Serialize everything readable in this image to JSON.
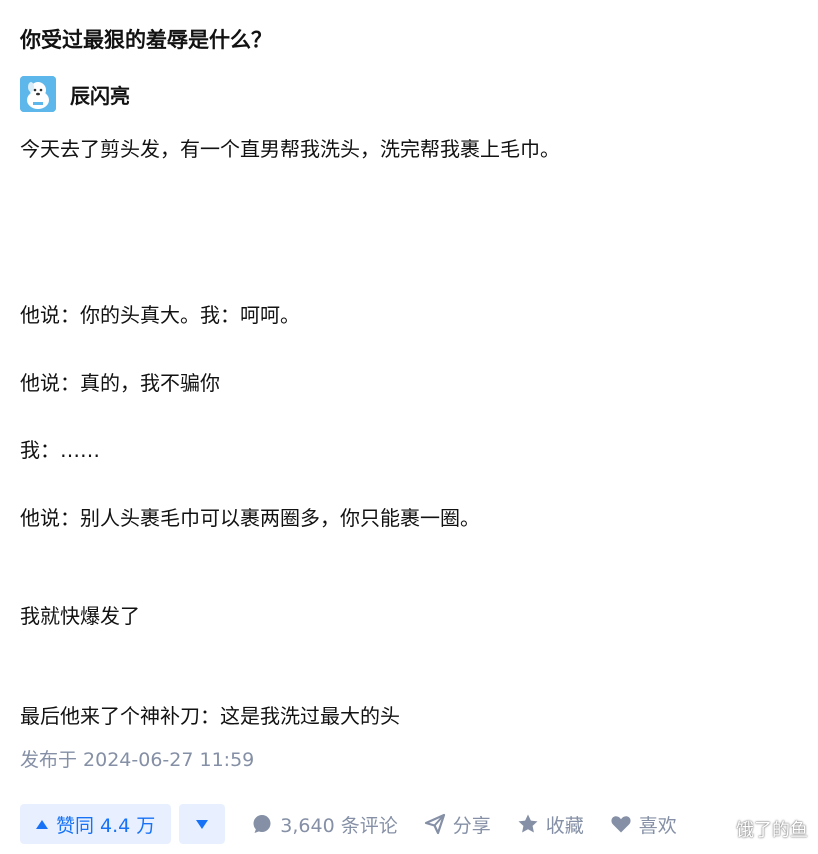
{
  "question": {
    "title": "你受过最狠的羞辱是什么？"
  },
  "author": {
    "name": "辰闪亮"
  },
  "answer": {
    "paragraphs": [
      "今天去了剪头发，有一个直男帮我洗头，洗完帮我裹上毛巾。",
      "他说：你的头真大。我：呵呵。",
      "他说：真的，我不骗你",
      "我：……",
      "他说：别人头裹毛巾可以裹两圈多，你只能裹一圈。",
      "我就快爆发了",
      "最后他来了个神补刀：这是我洗过最大的头"
    ],
    "published": "发布于 2024-06-27 11:59"
  },
  "actions": {
    "upvote_label": "赞同 4.4 万",
    "comments_label": "3,640 条评论",
    "share_label": "分享",
    "collect_label": "收藏",
    "like_label": "喜欢"
  },
  "watermark": {
    "text": "饿了的鱼"
  },
  "colors": {
    "accent": "#1772f6",
    "accent_bg": "#e8f0ff",
    "muted": "#8590a6",
    "avatar_bg": "#5eb7ea"
  }
}
